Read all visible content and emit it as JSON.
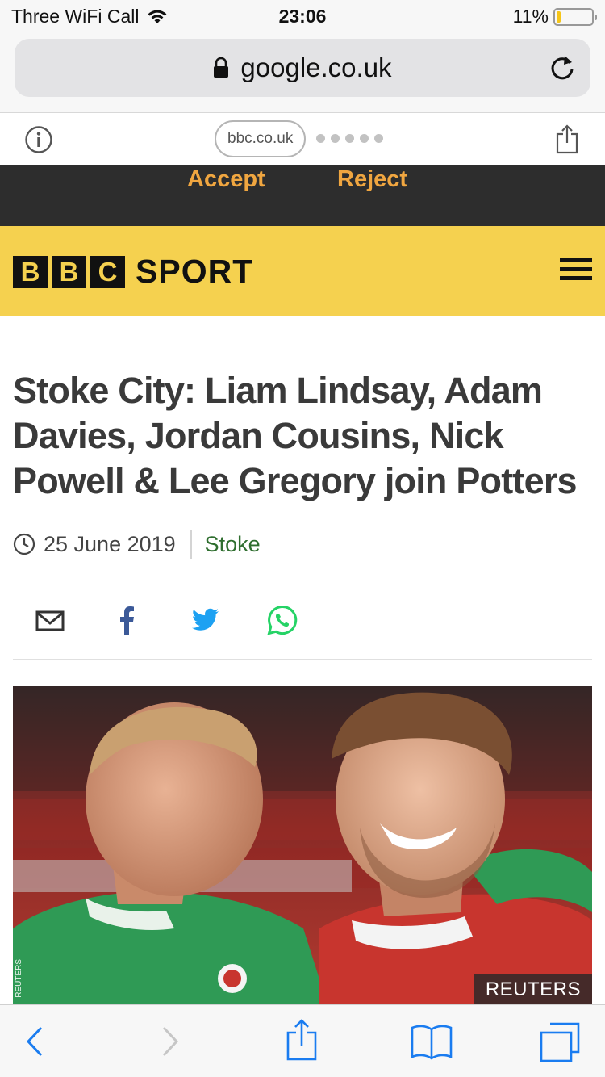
{
  "status": {
    "carrier": "Three WiFi Call",
    "time": "23:06",
    "battery_pct": "11%",
    "battery_level": 0.11,
    "battery_color": "#f5c518"
  },
  "browser": {
    "url": "google.co.uk",
    "amp_domain": "bbc.co.uk",
    "page_dot_count": 5
  },
  "cookie": {
    "accept_label": "Accept",
    "reject_label": "Reject",
    "accent_color": "#f0a640"
  },
  "header": {
    "logo_letters": [
      "B",
      "B",
      "C"
    ],
    "section": "SPORT",
    "brand_color": "#f5d14f"
  },
  "article": {
    "headline": "Stoke City: Liam Lindsay, Adam Davies, Jordan Cousins, Nick Powell & Lee Gregory join Potters",
    "date": "25 June 2019",
    "section": "Stoke",
    "share_icons": [
      "email-icon",
      "facebook-icon",
      "twitter-icon",
      "whatsapp-icon"
    ],
    "image_credit": "REUTERS",
    "image_side_credit": "REUTERS"
  },
  "toolbar": {
    "icons": [
      "back-icon",
      "forward-icon",
      "share-icon",
      "bookmarks-icon",
      "tabs-icon"
    ]
  }
}
